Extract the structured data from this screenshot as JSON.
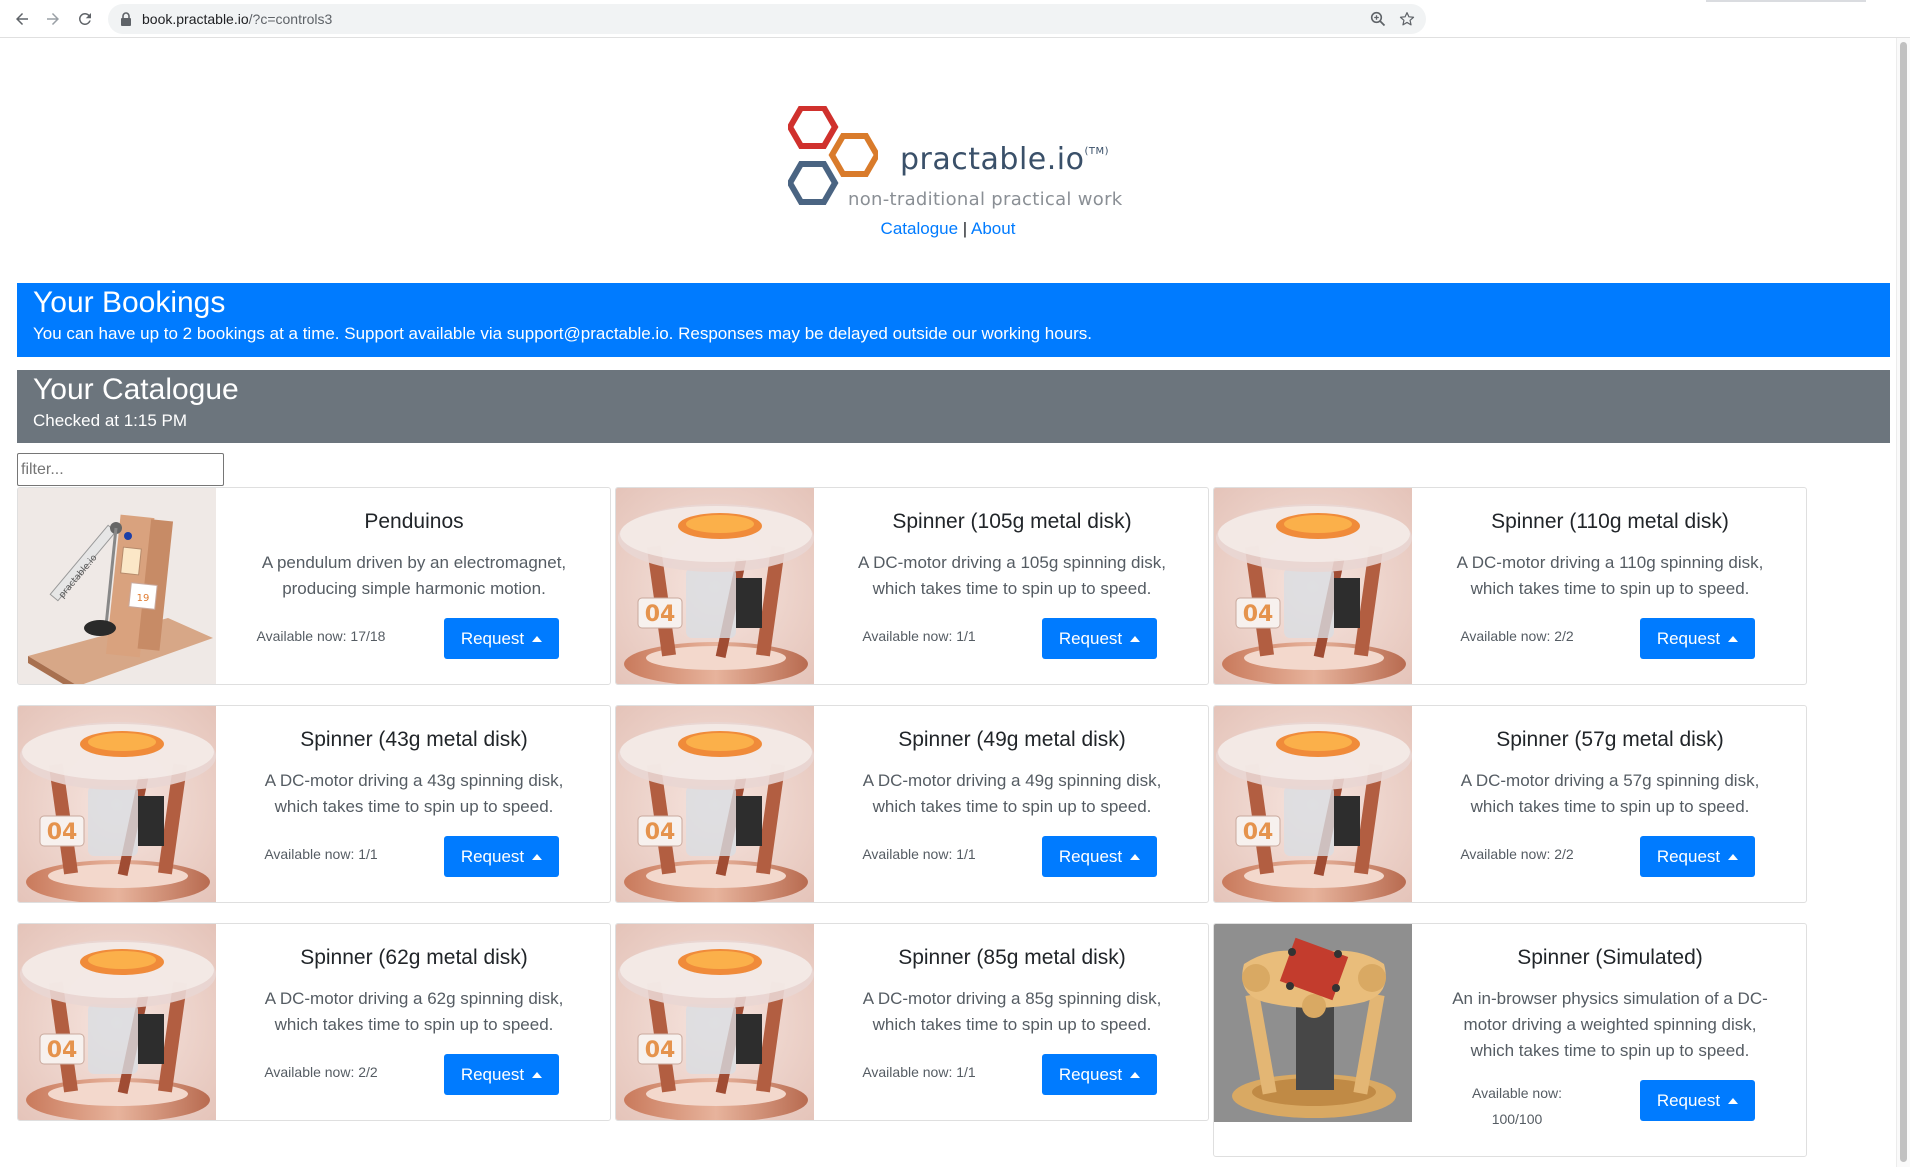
{
  "browser": {
    "url_host": "book.practable.io",
    "url_path": "/?c=controls3"
  },
  "header": {
    "brand": "practable.io",
    "trademark": "(TM)",
    "tagline": "non-traditional practical work",
    "links": {
      "catalogue": "Catalogue",
      "separator": "|",
      "about": "About"
    },
    "colors": {
      "hex_red": "#d0312d",
      "hex_orange": "#d97b2b",
      "hex_blue": "#4a6482"
    }
  },
  "bookings": {
    "title": "Your Bookings",
    "text": "You can have up to 2 bookings at a time. Support available via support@practable.io. Responses may be delayed outside our working hours.",
    "color": "#007bff"
  },
  "catalogue": {
    "title": "Your Catalogue",
    "checked": "Checked at 1:15 PM",
    "filter_placeholder": "filter...",
    "color": "#6c757d"
  },
  "experiments": [
    {
      "title": "Penduinos",
      "desc": "A pendulum driven by an electromagnet, producing simple harmonic motion.",
      "avail": "Available now: 17/18",
      "button": "Request",
      "image": "pendulum"
    },
    {
      "title": "Spinner (105g metal disk)",
      "desc": "A DC-motor driving a 105g spinning disk, which takes time to spin up to speed.",
      "avail": "Available now: 1/1",
      "button": "Request",
      "image": "spinner"
    },
    {
      "title": "Spinner (110g metal disk)",
      "desc": "A DC-motor driving a 110g spinning disk, which takes time to spin up to speed.",
      "avail": "Available now: 2/2",
      "button": "Request",
      "image": "spinner"
    },
    {
      "title": "Spinner (43g metal disk)",
      "desc": "A DC-motor driving a 43g spinning disk, which takes time to spin up to speed.",
      "avail": "Available now: 1/1",
      "button": "Request",
      "image": "spinner"
    },
    {
      "title": "Spinner (49g metal disk)",
      "desc": "A DC-motor driving a 49g spinning disk, which takes time to spin up to speed.",
      "avail": "Available now: 1/1",
      "button": "Request",
      "image": "spinner"
    },
    {
      "title": "Spinner (57g metal disk)",
      "desc": "A DC-motor driving a 57g spinning disk, which takes time to spin up to speed.",
      "avail": "Available now: 2/2",
      "button": "Request",
      "image": "spinner"
    },
    {
      "title": "Spinner (62g metal disk)",
      "desc": "A DC-motor driving a 62g spinning disk, which takes time to spin up to speed.",
      "avail": "Available now: 2/2",
      "button": "Request",
      "image": "spinner"
    },
    {
      "title": "Spinner (85g metal disk)",
      "desc": "A DC-motor driving a 85g spinning disk, which takes time to spin up to speed.",
      "avail": "Available now: 1/1",
      "button": "Request",
      "image": "spinner"
    },
    {
      "title": "Spinner (Simulated)",
      "desc": "An in-browser physics simulation of a DC-motor driving a weighted spinning disk, which takes time to spin up to speed.",
      "avail_line1": "Available now:",
      "avail_line2": "100/100",
      "button": "Request",
      "image": "simulated"
    }
  ],
  "spinner_label": "04",
  "pendulum_label": "practable.io",
  "pendulum_number": "19"
}
